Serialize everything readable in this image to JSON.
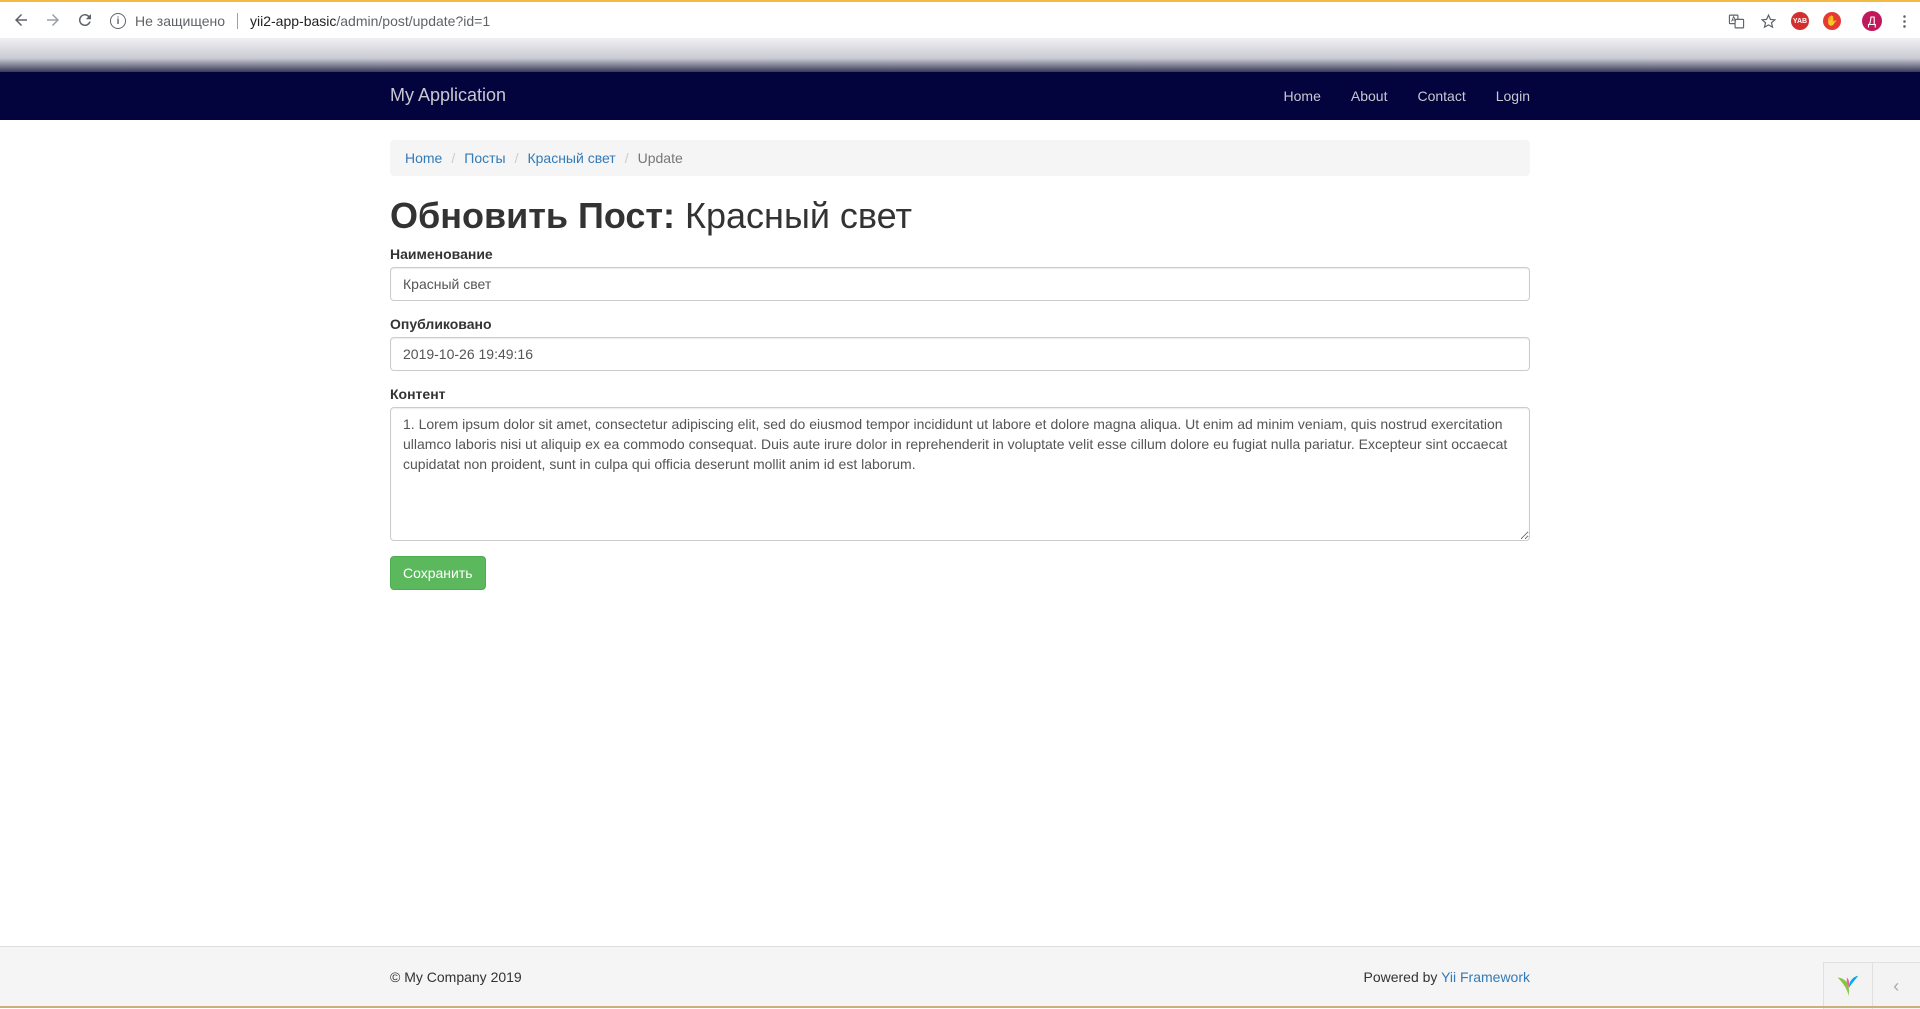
{
  "browser": {
    "security_label": "Не защищено",
    "url_host": "yii2-app-basic",
    "url_path": "/admin/post/update?id=1",
    "profile_initial": "Д",
    "ext_badge_text": "YAB"
  },
  "navbar": {
    "brand": "My Application",
    "links": [
      "Home",
      "About",
      "Contact",
      "Login"
    ]
  },
  "breadcrumb": {
    "items": [
      "Home",
      "Посты",
      "Красный свет"
    ],
    "active": "Update",
    "separator": "/"
  },
  "page": {
    "title_bold": "Обновить Пост:",
    "title_rest": "Красный свет"
  },
  "form": {
    "name_label": "Наименование",
    "name_value": "Красный свет",
    "published_label": "Опубликовано",
    "published_value": "2019-10-26 19:49:16",
    "content_label": "Контент",
    "content_value": "1. Lorem ipsum dolor sit amet, consectetur adipiscing elit, sed do eiusmod tempor incididunt ut labore et dolore magna aliqua. Ut enim ad minim veniam, quis nostrud exercitation ullamco laboris nisi ut aliquip ex ea commodo consequat. Duis aute irure dolor in reprehenderit in voluptate velit esse cillum dolore eu fugiat nulla pariatur. Excepteur sint occaecat cupidatat non proident, sunt in culpa qui officia deserunt mollit anim id est laborum.",
    "submit_label": "Сохранить"
  },
  "footer": {
    "copyright": "© My Company 2019",
    "powered_prefix": "Powered by",
    "powered_link": "Yii Framework"
  },
  "colors": {
    "navbar_bg": "#03033d",
    "link": "#337ab7",
    "success": "#5cb85c"
  },
  "icons": [
    "back-arrow-icon",
    "forward-arrow-icon",
    "reload-icon",
    "info-icon",
    "translate-icon",
    "star-icon",
    "menu-dots-icon",
    "yii-logo-icon",
    "chevron-left-icon"
  ]
}
